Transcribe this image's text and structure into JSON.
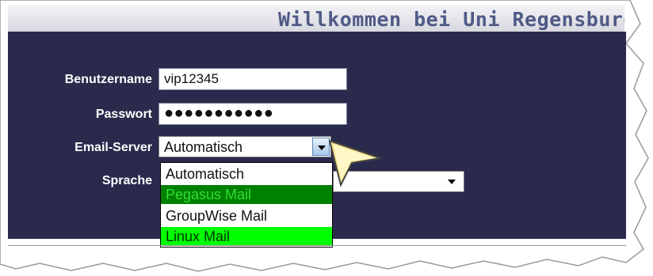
{
  "header": {
    "title": "Willkommen bei Uni Regensburg"
  },
  "form": {
    "username_label": "Benutzername",
    "username_value": "vip12345",
    "password_label": "Passwort",
    "password_mask": "●●●●●●●●●●●",
    "server_label": "Email-Server",
    "server_selected": "Automatisch",
    "language_label": "Sprache",
    "server_options": [
      {
        "label": "Automatisch",
        "state": "normal"
      },
      {
        "label": "Pegasus Mail",
        "state": "highlighted-dark-green"
      },
      {
        "label": "GroupWise Mail",
        "state": "normal"
      },
      {
        "label": "Linux Mail",
        "state": "highlighted-bright-green"
      }
    ]
  },
  "icons": {
    "dropdown": "chevron-down-icon",
    "pointer": "pointer-arrow-icon"
  },
  "colors": {
    "panel": "#2a2a4d",
    "title": "#4f5a86",
    "pegasus_bg": "#008000",
    "linux_bg": "#00ff00"
  }
}
